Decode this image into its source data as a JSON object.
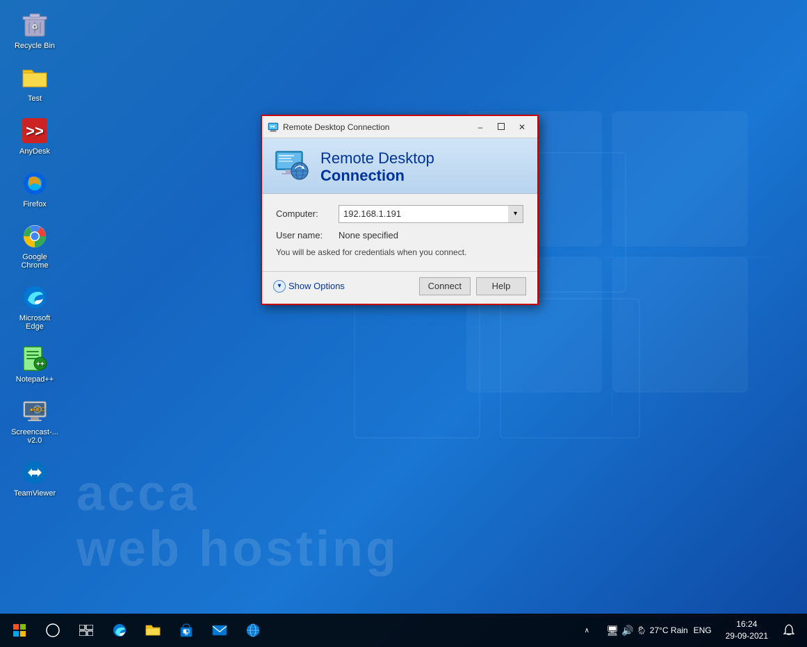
{
  "desktop": {
    "background_color": "#1565c0",
    "watermark_line1": "acca",
    "watermark_line2": "web hosting"
  },
  "icons": [
    {
      "id": "recycle-bin",
      "label": "Recycle Bin",
      "emoji": "🗑️"
    },
    {
      "id": "test",
      "label": "Test",
      "emoji": "📁"
    },
    {
      "id": "anydesk",
      "label": "AnyDesk",
      "emoji": "🔴"
    },
    {
      "id": "firefox",
      "label": "Firefox",
      "emoji": "🦊"
    },
    {
      "id": "google-chrome",
      "label": "Google Chrome",
      "emoji": "🔵"
    },
    {
      "id": "microsoft-edge",
      "label": "Microsoft Edge",
      "emoji": "🌐"
    },
    {
      "id": "notepadpp",
      "label": "Notepad++",
      "emoji": "📝"
    },
    {
      "id": "screencast",
      "label": "Screencast-...\nv2.0",
      "emoji": "🖥️"
    },
    {
      "id": "teamviewer",
      "label": "TeamViewer",
      "emoji": "🔁"
    }
  ],
  "rdp_dialog": {
    "title": "Remote Desktop Connection",
    "header_line1": "Remote Desktop",
    "header_line2": "Connection",
    "computer_label": "Computer:",
    "computer_value": "192.168.1.191",
    "username_label": "User name:",
    "username_value": "None specified",
    "note_text": "You will be asked for credentials when you connect.",
    "show_options_label": "Show Options",
    "connect_btn": "Connect",
    "help_btn": "Help",
    "minimize_label": "–",
    "restore_label": "🗗",
    "close_label": "✕"
  },
  "taskbar": {
    "start_icon": "⊞",
    "search_icon": "○",
    "task_view": "⧉",
    "weather": "27°C Rain",
    "language": "ENG",
    "time": "16:24",
    "date": "29-09-2021",
    "notification_icon": "🔔",
    "taskbar_apps": [
      "⊞",
      "○",
      "⧉",
      "🌐",
      "📁",
      "🛒",
      "✉",
      "🌍"
    ]
  }
}
